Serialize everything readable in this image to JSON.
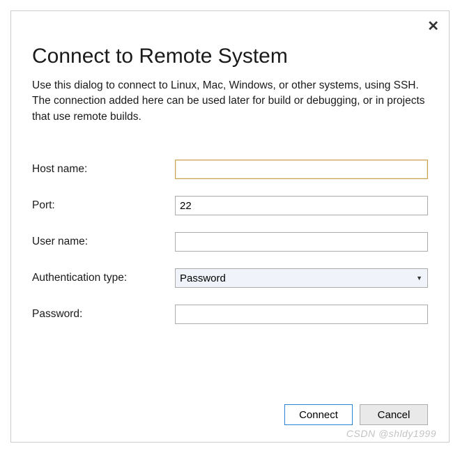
{
  "dialog": {
    "title": "Connect to Remote System",
    "description": "Use this dialog to connect to Linux, Mac, Windows, or other systems, using SSH. The connection added here can be used later for build or debugging, or in projects that use remote builds.",
    "close_symbol": "✕"
  },
  "form": {
    "hostname": {
      "label": "Host name:",
      "value": ""
    },
    "port": {
      "label": "Port:",
      "value": "22"
    },
    "username": {
      "label": "User name:",
      "value": ""
    },
    "authtype": {
      "label": "Authentication type:",
      "selected": "Password"
    },
    "password": {
      "label": "Password:",
      "value": ""
    }
  },
  "buttons": {
    "connect": "Connect",
    "cancel": "Cancel"
  },
  "watermark": "CSDN @shldy1999"
}
